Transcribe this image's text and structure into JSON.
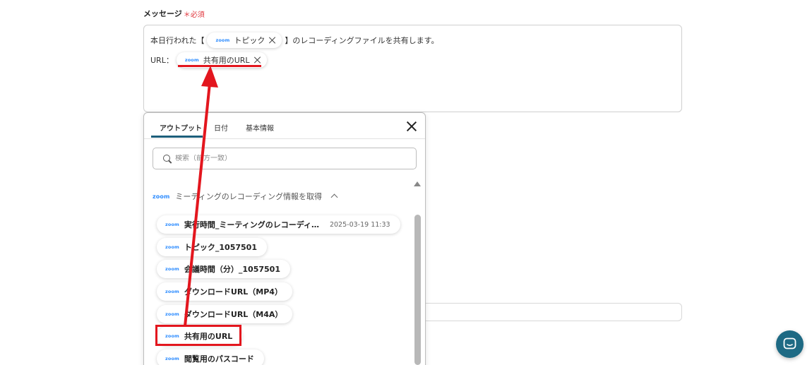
{
  "form": {
    "label": "メッセージ",
    "required_mark": "＊必須",
    "message": {
      "line1_before": "本日行われた【",
      "line1_chip": "トピック",
      "line1_after": "】のレコーディングファイルを共有します。",
      "line2_before": "URL：",
      "line2_chip": "共有用のURL"
    },
    "zoom_logo_text": "zoom"
  },
  "panel": {
    "tabs": [
      {
        "label": "アウトプット",
        "active": true
      },
      {
        "label": "日付",
        "active": false
      },
      {
        "label": "基本情報",
        "active": false
      }
    ],
    "search_placeholder": "検索（前方一致）",
    "group_title": "ミーティングのレコーディング情報を取得",
    "items": [
      {
        "label": "実行時間_ミーティングのレコーディ…",
        "value": "2025-03-19 11:33"
      },
      {
        "label": "トピック_1057501",
        "value": ""
      },
      {
        "label": "会議時間（分）_1057501",
        "value": ""
      },
      {
        "label": "ダウンロードURL（MP4）",
        "value": ""
      },
      {
        "label": "ダウンロードURL（M4A）",
        "value": ""
      },
      {
        "label": "共有用のURL",
        "value": ""
      },
      {
        "label": "閲覧用のパスコード",
        "value": ""
      }
    ]
  },
  "colors": {
    "accent": "#1e6a84",
    "highlight": "#e3161e",
    "zoom": "#2d8cff",
    "required": "#e0343b"
  },
  "icons": [
    "close-icon",
    "search-icon",
    "chevron-up-icon",
    "chat-icon",
    "zoom-logo"
  ]
}
